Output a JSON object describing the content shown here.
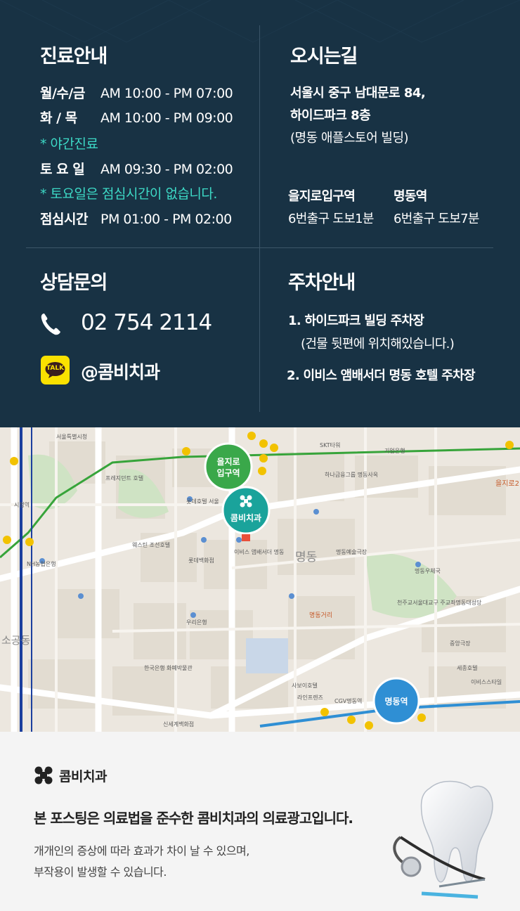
{
  "hours": {
    "title": "진료안내",
    "rows": [
      {
        "label": "월/수/금",
        "time": "AM 10:00 - PM 07:00"
      },
      {
        "label": "화 / 목",
        "time": "AM 10:00 - PM 09:00"
      },
      {
        "label": "토 요 일",
        "time": "AM 09:30 - PM 02:00"
      },
      {
        "label": "점심시간",
        "time": "PM 01:00 - PM 02:00"
      }
    ],
    "night_note": "* 야간진료",
    "saturday_note": "* 토요일은 점심시간이 없습니다."
  },
  "directions": {
    "title": "오시는길",
    "address_line1": "서울시 중구 남대문로 84,",
    "address_line2": "하이드파크 8층",
    "address_line3": "(명동 애플스토어 빌딩)",
    "stations": [
      {
        "name": "을지로입구역",
        "exit": "6번출구 도보1분"
      },
      {
        "name": "명동역",
        "exit": "6번출구 도보7분"
      }
    ]
  },
  "contact": {
    "title": "상담문의",
    "phone": "02 754 2114",
    "phone_icon": "phone-icon",
    "kakao_badge": "TALK",
    "kakao_icon": "kakaotalk-icon",
    "kakao_id": "@콤비치과"
  },
  "parking": {
    "title": "주차안내",
    "item1": "1. 하이드파크 빌딩 주차장",
    "item1_sub": "(건물 뒷편에 위치해있습니다.)",
    "item2": "2. 이비스 앰배서더 명동 호텔 주차장"
  },
  "map": {
    "station_euljiro_line1": "을지로",
    "station_euljiro_line2": "입구역",
    "clinic_marker": "콤비치과",
    "station_myeongdong": "명동역",
    "labels": {
      "city_hall": "시청역",
      "myeongdong": "명동",
      "myeongdong_street": "명동거리",
      "sogong": "소공동",
      "lotte_hotel": "롯데호텔 서울",
      "lotte_dept": "롯데백화점",
      "hanaro": "하나금융그룹 명동사옥",
      "myeongdong_cathedral": "천주교서울대교구 주교좌명동대성당",
      "woori_bank": "우리은행",
      "ibis": "이비스 앰배서더 명동",
      "bank_of_korea": "한국은행 화폐박물관",
      "shinsegae": "신세계백화점",
      "westin": "웨스틴 조선호텔",
      "seoul_metro": "서울특별시청",
      "nh": "NH농협은행",
      "plaza": "프레지던트 호텔",
      "euljiro_sq": "을지로2",
      "kiup": "기업은행",
      "skt": "SKT타워",
      "post": "명동우체국",
      "savoy": "사보이호텔",
      "lining": "라인프렌즈",
      "egv": "CGV명동역",
      "myeongdong_theater": "명동예술극장",
      "sejong": "세종호텔",
      "ewha": "이비스스타일",
      "central_theater": "중앙극장"
    },
    "brand_color": "#1aa39b",
    "line2_color": "#37a43a",
    "line4_color": "#2f8fd4"
  },
  "footer": {
    "brand_icon": "combi-logo-icon",
    "brand_name": "콤비치과",
    "disclaimer_main": "본 포스팅은 의료법을 준수한 콤비치과의 의료광고입니다.",
    "disclaimer_line1": "개개인의 증상에 따라 효과가 차이 날 수 있으며,",
    "disclaimer_line2": "부작용이 발생할 수 있습니다.",
    "tooth_image": "tooth-stethoscope-image"
  },
  "colors": {
    "panel_bg": "#183244",
    "accent_teal": "#3dd9c6",
    "divider": "#3b5568"
  }
}
